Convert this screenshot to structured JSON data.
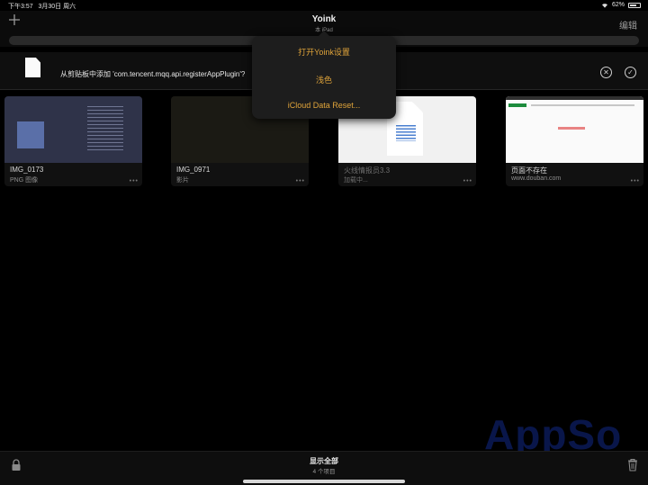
{
  "status_bar": {
    "time": "下午3:57",
    "date": "3月30日 周六",
    "battery": "62%"
  },
  "nav": {
    "title": "Yoink",
    "subtitle": "本 iPad",
    "edit_label": "编辑",
    "add_icon": "plus-icon"
  },
  "clipboard_prompt": {
    "text": "从剪贴板中添加 'com.tencent.mqq.api.registerAppPlugin'?",
    "cancel_icon": "x-circle-icon",
    "confirm_icon": "check-circle-icon"
  },
  "menu": {
    "items": [
      {
        "label": "打开Yoink设置"
      },
      {
        "label": "浅色"
      },
      {
        "label": "iCloud Data Reset..."
      }
    ]
  },
  "items": [
    {
      "title": "IMG_0173",
      "subtitle": "PNG 图像"
    },
    {
      "title": "IMG_0971",
      "subtitle": "影片"
    },
    {
      "title": "火线情报员3.3",
      "subtitle": "加载中..."
    },
    {
      "title": "页面不存在",
      "subtitle": "www.douban.com"
    }
  ],
  "more_glyph": "•••",
  "bottom_bar": {
    "show_all": "显示全部",
    "count": "4 个项目"
  },
  "watermark": "AppSo",
  "colors": {
    "accent": "#e0a43a",
    "background": "#000000"
  }
}
